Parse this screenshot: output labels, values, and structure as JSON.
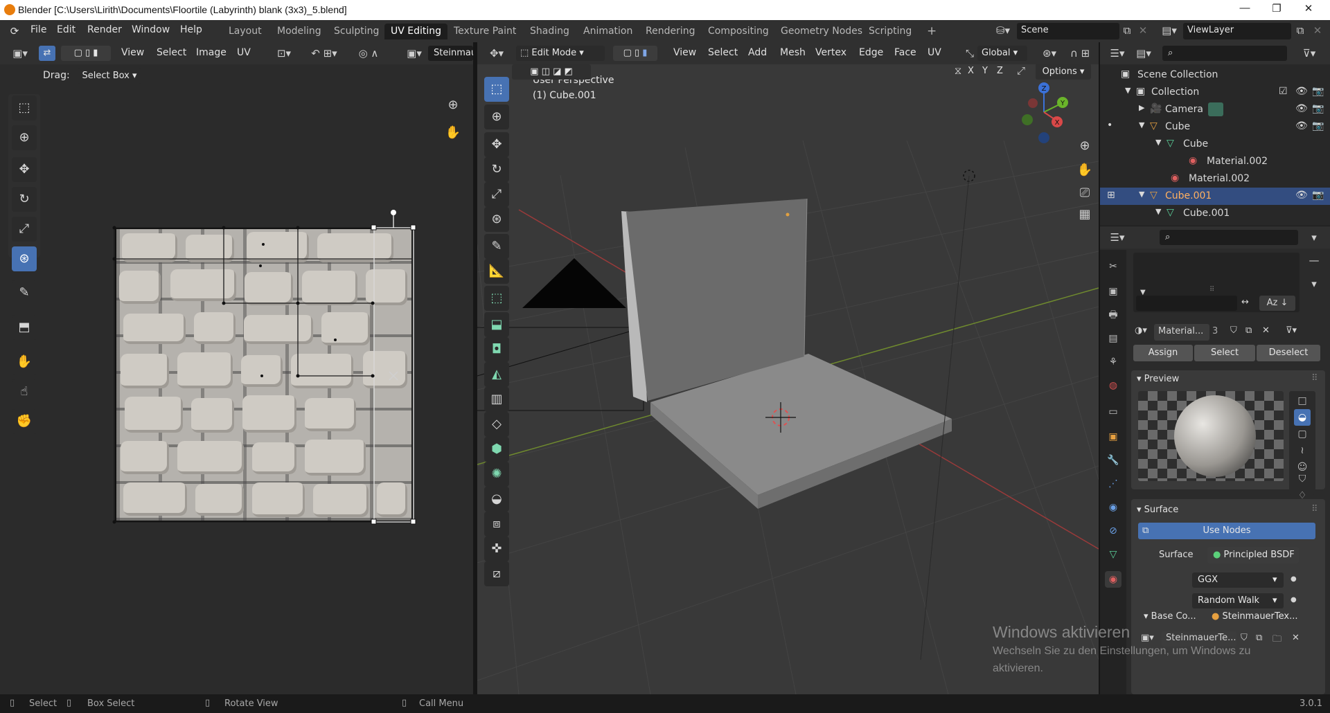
{
  "window": {
    "title": "Blender [C:\\Users\\Lirith\\Documents\\Floortile (Labyrinth) blank (3x3)_5.blend]",
    "controls": [
      "—",
      "❐",
      "✕"
    ]
  },
  "menu": [
    "File",
    "Edit",
    "Render",
    "Window",
    "Help"
  ],
  "workspaces": {
    "tabs": [
      "Layout",
      "Modeling",
      "Sculpting",
      "UV Editing",
      "Texture Paint",
      "Shading",
      "Animation",
      "Rendering",
      "Compositing",
      "Geometry Nodes",
      "Scripting"
    ],
    "active": "UV Editing",
    "add_label": "+"
  },
  "scene": {
    "label": "Scene",
    "view_layer": "ViewLayer"
  },
  "uv_editor": {
    "header_menus": [
      "View",
      "Select",
      "Image",
      "UV"
    ],
    "image_name": "Steinmau",
    "drag_label": "Drag:",
    "drag_value": "Select Box"
  },
  "viewport": {
    "mode": "Edit Mode",
    "header_menus": [
      "View",
      "Select",
      "Add",
      "Mesh",
      "Vertex",
      "Edge",
      "Face",
      "UV"
    ],
    "orientation": "Global",
    "axes": [
      "X",
      "Y",
      "Z"
    ],
    "options_label": "Options",
    "perspective_label": "User Perspective",
    "object_label": "(1) Cube.001",
    "gizmo": {
      "z": "Z",
      "y": "Y",
      "x": "X"
    }
  },
  "outliner": {
    "rows": [
      {
        "label": "Scene Collection",
        "icon": "scene-collection-icon"
      },
      {
        "label": "Collection",
        "icon": "collection-icon"
      },
      {
        "label": "Camera",
        "icon": "camera-icon"
      },
      {
        "label": "Cube",
        "icon": "mesh-object-icon"
      },
      {
        "label": "Cube",
        "icon": "mesh-data-icon"
      },
      {
        "label": "Material.002",
        "icon": "material-icon"
      },
      {
        "label": "Material.002",
        "icon": "material-icon"
      },
      {
        "label": "Cube.001",
        "icon": "mesh-object-icon",
        "selected": true
      },
      {
        "label": "Cube.001",
        "icon": "mesh-data-icon"
      }
    ]
  },
  "properties": {
    "material_name": "Material...",
    "user_count": "3",
    "assign_label": "Assign",
    "select_label": "Select",
    "deselect_label": "Deselect",
    "preview_label": "Preview",
    "surface_section_label": "Surface",
    "use_nodes_label": "Use Nodes",
    "surface_label": "Surface",
    "surface_value": "Principled BSDF",
    "distribution": "GGX",
    "subsurface_method": "Random Walk",
    "base_color_label": "Base Co...",
    "base_color_value": "SteinmauerTex...",
    "image_value": "SteinmauerTe..."
  },
  "watermark": {
    "title": "Windows aktivieren",
    "line1": "Wechseln Sie zu den Einstellungen, um Windows zu",
    "line2": "aktivieren."
  },
  "statusbar": {
    "select": "Select",
    "box_select": "Box Select",
    "rotate_view": "Rotate View",
    "call_menu": "Call Menu",
    "version": "3.0.1"
  },
  "colors": {
    "accent": "#4772b3",
    "selection": "#334d80",
    "header": "#303030",
    "viewport_bg": "#393939"
  }
}
